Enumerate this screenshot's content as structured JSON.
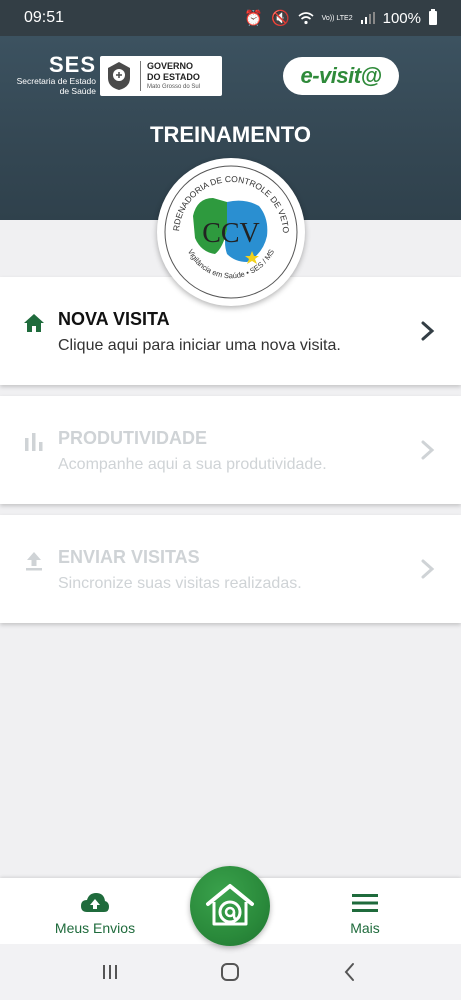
{
  "status_bar": {
    "time": "09:51",
    "network": "Vo)) LTE2",
    "battery": "100%"
  },
  "header": {
    "ses_title": "SES",
    "ses_subtitle": "Secretaria de Estado de Saúde",
    "gov_line1": "GOVERNO",
    "gov_line2": "DO ESTADO",
    "gov_line3": "Mato Grosso do Sul",
    "app_logo": "e-visit@",
    "title": "TREINAMENTO"
  },
  "ccv_logo": {
    "ring_text_top": "COORDENADORIA DE CONTROLE DE VETORES",
    "center_text": "CCV",
    "ring_text_bottom": "Vigilância em Saúde • SES / MS"
  },
  "cards": [
    {
      "title": "NOVA VISITA",
      "description": "Clique aqui para iniciar uma nova visita.",
      "icon": "home-icon",
      "enabled": true
    },
    {
      "title": "PRODUTIVIDADE",
      "description": "Acompanhe aqui a sua produtividade.",
      "icon": "bar-chart-icon",
      "enabled": false
    },
    {
      "title": "ENVIAR VISITAS",
      "description": "Sincronize suas visitas realizadas.",
      "icon": "upload-icon",
      "enabled": false
    }
  ],
  "bottom_nav": {
    "left_label": "Meus Envios",
    "right_label": "Mais",
    "fab_icon": "house-at-icon"
  },
  "colors": {
    "header": "#344753",
    "accent_green": "#1f6b3c",
    "fab_green": "#2a8a3b",
    "disabled_text": "#cfd3d6"
  }
}
